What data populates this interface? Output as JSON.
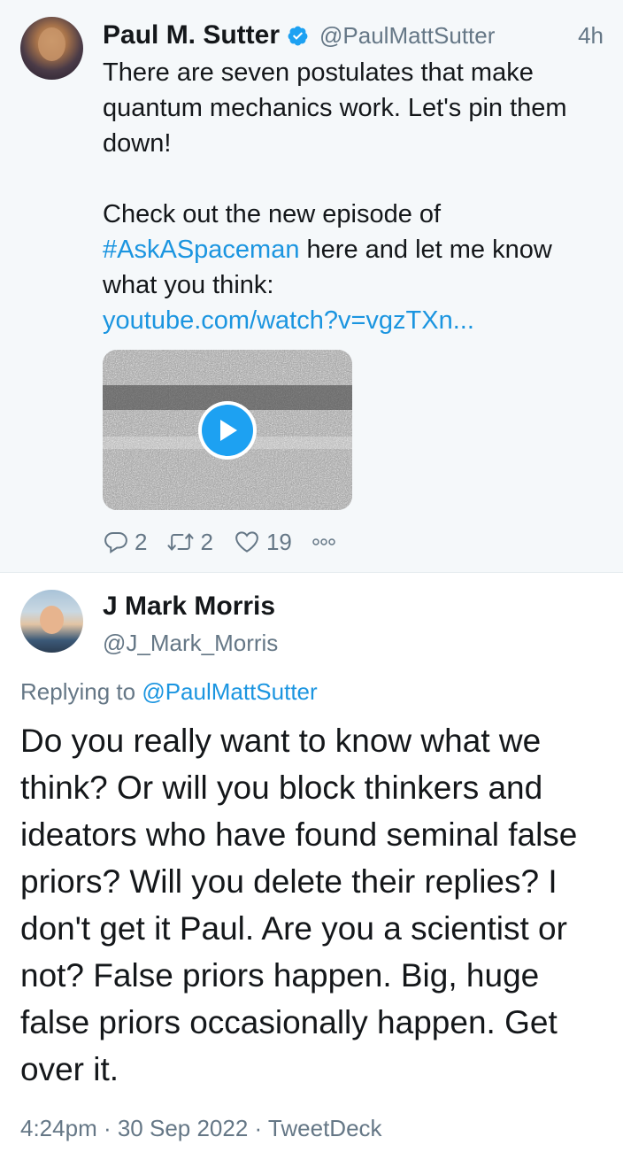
{
  "parent_tweet": {
    "author_name": "Paul M. Sutter",
    "verified": true,
    "handle": "@PaulMattSutter",
    "time": "4h",
    "text_intro": "There are seven postulates that make quantum mechanics work. Let's pin them down!",
    "text_line2_before": "Check out the new episode of ",
    "hashtag": "#AskASpaceman",
    "text_line2_after": " here and let me know what you think:",
    "link": "youtube.com/watch?v=vgzTXn...",
    "media": {
      "type": "video-thumbnail",
      "icon": "play-icon"
    },
    "actions": {
      "replies": "2",
      "retweets": "2",
      "likes": "19",
      "more_icon": "more-dots-icon"
    }
  },
  "reply_tweet": {
    "author_name": "J Mark Morris",
    "handle": "@J_Mark_Morris",
    "replying_label": "Replying to ",
    "replying_to": "@PaulMattSutter",
    "text": "Do you really want to know what we think?  Or will you block thinkers and ideators who have found seminal false priors? Will you delete their replies? I don't get it Paul. Are you a scientist or not? False priors happen. Big, huge false priors occasionally happen. Get over it.",
    "meta": "4:24pm · 30 Sep 2022 · TweetDeck"
  },
  "colors": {
    "link": "#1b95e0",
    "secondary_text": "#657786",
    "primary_text": "#14171a",
    "verified": "#1da1f2",
    "parent_background": "#f5f8fa"
  }
}
